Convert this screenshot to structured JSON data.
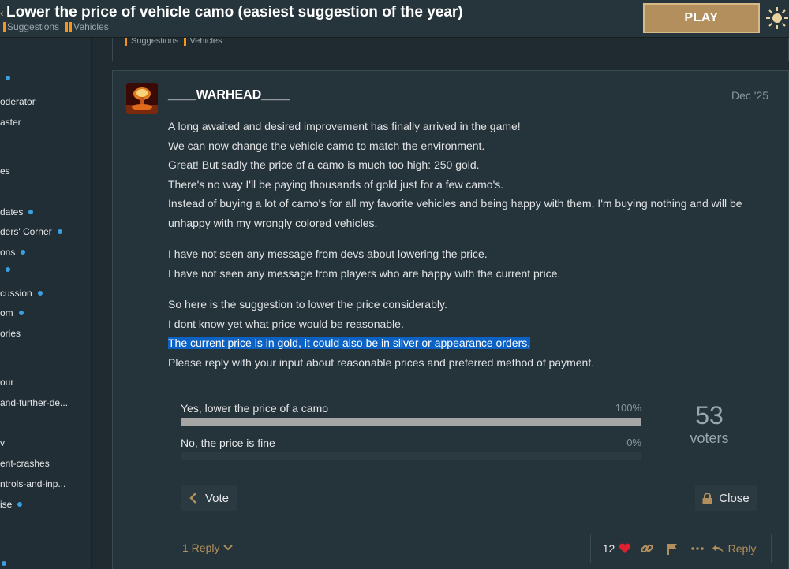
{
  "topic": {
    "title": "Lower the price of vehicle camo (easiest suggestion of the year)",
    "categories": [
      "Suggestions",
      "Vehicles"
    ]
  },
  "header": {
    "play_label": "PLAY"
  },
  "sidebar": {
    "items": [
      {
        "label": "",
        "dot": true
      },
      {
        "label": "oderator",
        "dot": false
      },
      {
        "label": "aster",
        "dot": false
      },
      {
        "label": "es",
        "dot": false
      },
      {
        "label": "dates",
        "dot": true
      },
      {
        "label": "ders' Corner",
        "dot": true
      },
      {
        "label": "ons",
        "dot": true
      },
      {
        "label": "",
        "dot": true
      },
      {
        "label": "cussion",
        "dot": true
      },
      {
        "label": "om",
        "dot": true
      },
      {
        "label": "ories",
        "dot": false
      },
      {
        "label": "our",
        "dot": false
      },
      {
        "label": "and-further-de...",
        "dot": false
      },
      {
        "label": "v",
        "dot": false
      },
      {
        "label": "ent-crashes",
        "dot": false
      },
      {
        "label": "ntrols-and-inp...",
        "dot": false
      },
      {
        "label": "ise",
        "dot": true
      }
    ]
  },
  "post": {
    "username": "____WARHEAD____",
    "date": "Dec '25",
    "paragraphs": [
      [
        "A long awaited and desired improvement has finally arrived in the game!",
        "We can now change the vehicle camo to match the environment.",
        "Great! But sadly the price of a camo is much too high: 250 gold.",
        "There's no way I'll be paying thousands of gold just for a few camo's.",
        "Instead of buying a lot of camo's for all my favorite vehicles and being happy with them, I'm buying nothing and will be unhappy with my wrongly colored vehicles."
      ],
      [
        "I have not seen any message from devs about lowering the price.",
        "I have not seen any message from players who are happy with the current price."
      ],
      [
        "So here is the suggestion to lower the price considerably.",
        "I dont know yet what price would be reasonable.",
        "The current price is in gold, it could also be in silver or appearance orders.",
        "Please reply with your input about reasonable prices and preferred method of payment."
      ]
    ],
    "highlighted_line": "The current price is in gold, it could also be in silver or appearance orders."
  },
  "poll": {
    "options": [
      {
        "label": "Yes, lower the price of a camo",
        "percent_label": "100%",
        "percent": 100
      },
      {
        "label": "No, the price is fine",
        "percent_label": "0%",
        "percent": 0
      }
    ],
    "voters_count": "53",
    "voters_label": "voters",
    "vote_label": "Vote",
    "close_label": "Close"
  },
  "footer": {
    "replies_label": "1 Reply",
    "likes": "12",
    "reply_label": "Reply"
  },
  "colors": {
    "accent": "#b28f5c",
    "category_bar": "#f7941d",
    "like_heart": "#e0202e",
    "highlight": "#0b62c4"
  }
}
